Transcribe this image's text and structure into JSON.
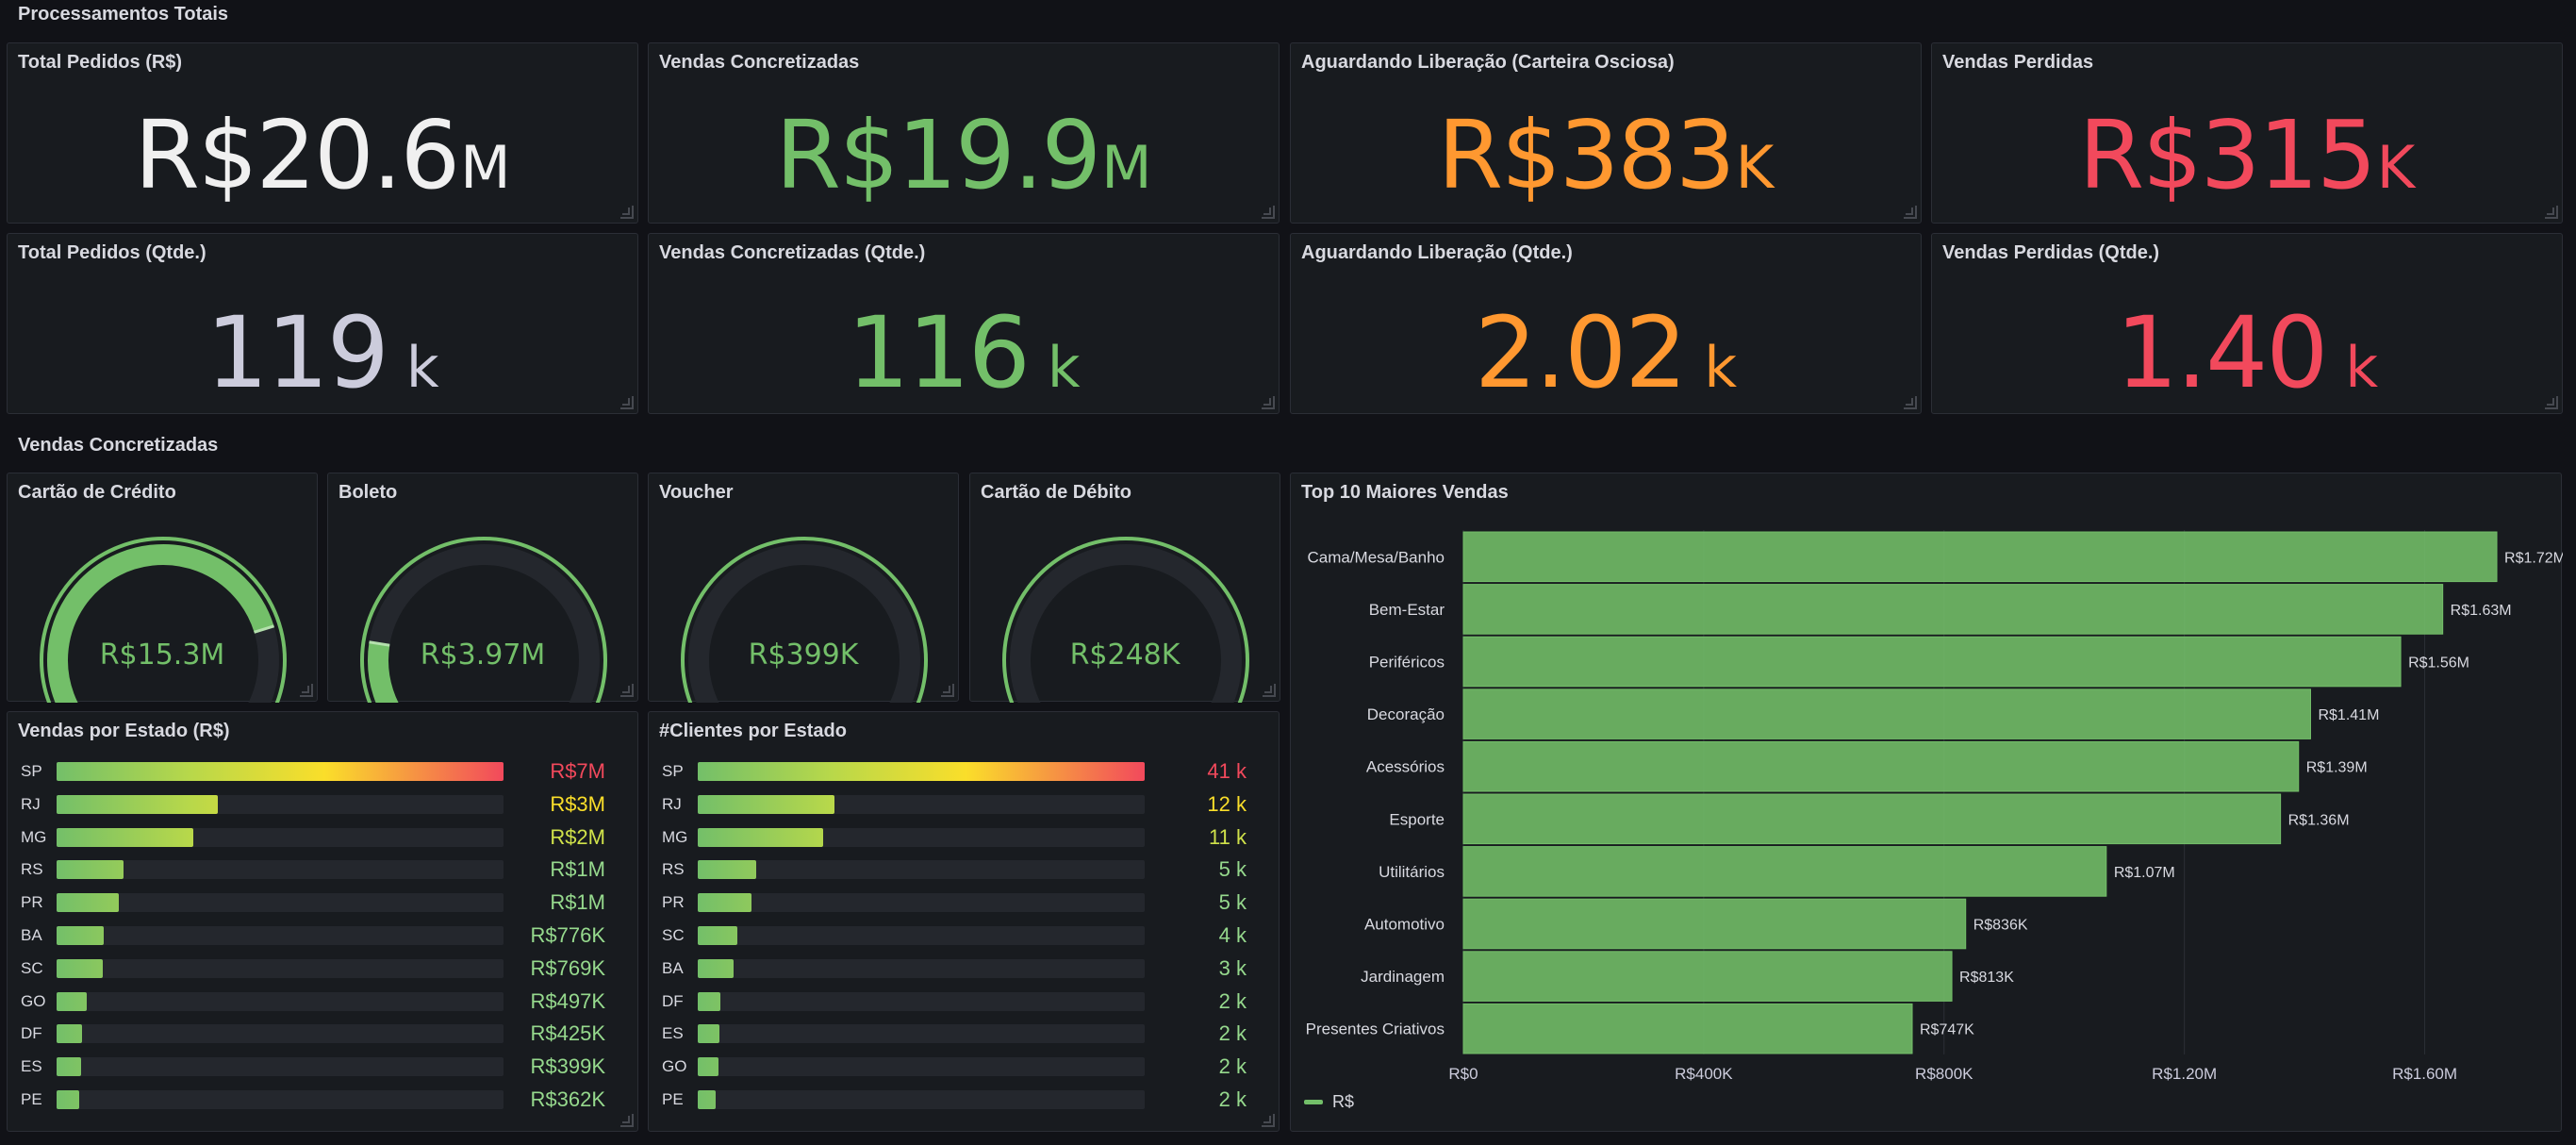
{
  "rows": {
    "totals": "Processamentos Totais",
    "concretized": "Vendas Concretizadas"
  },
  "stats": [
    {
      "title": "Total Pedidos (R$)",
      "value": "R$20.6",
      "unit": "M",
      "color": "#f0f0f0"
    },
    {
      "title": "Vendas Concretizadas",
      "value": "R$19.9",
      "unit": "M",
      "color": "#73bf69"
    },
    {
      "title": "Aguardando Liberação (Carteira Osciosa)",
      "value": "R$383",
      "unit": "K",
      "color": "#ff9830"
    },
    {
      "title": "Vendas Perdidas",
      "value": "R$315",
      "unit": "K",
      "color": "#f2495c"
    },
    {
      "title": "Total Pedidos (Qtde.)",
      "value": "119",
      "unit": "k",
      "color": "#ccccdc"
    },
    {
      "title": "Vendas Concretizadas (Qtde.)",
      "value": "116",
      "unit": "k",
      "color": "#73bf69"
    },
    {
      "title": "Aguardando Liberação (Qtde.)",
      "value": "2.02",
      "unit": "k",
      "color": "#ff9830"
    },
    {
      "title": "Vendas Perdidas (Qtde.)",
      "value": "1.40",
      "unit": "k",
      "color": "#f2495c"
    }
  ],
  "gauges": [
    {
      "title": "Cartão de Crédito",
      "value": "R$15.3M",
      "fraction": 0.77
    },
    {
      "title": "Boleto",
      "value": "R$3.97M",
      "fraction": 0.2
    },
    {
      "title": "Voucher",
      "value": "R$399K",
      "fraction": 0.025
    },
    {
      "title": "Cartão de Débito",
      "value": "R$248K",
      "fraction": 0.015
    }
  ],
  "states_value": {
    "title": "Vendas por Estado (R$)",
    "rows": [
      {
        "state": "SP",
        "value": "R$7M",
        "fraction": 1.0,
        "color": "#f2495c"
      },
      {
        "state": "RJ",
        "value": "R$3M",
        "fraction": 0.36,
        "color": "#fade2a"
      },
      {
        "state": "MG",
        "value": "R$2M",
        "fraction": 0.305,
        "color": "#d0e24a"
      },
      {
        "state": "RS",
        "value": "R$1M",
        "fraction": 0.15,
        "color": "#96d98d"
      },
      {
        "state": "PR",
        "value": "R$1M",
        "fraction": 0.14,
        "color": "#96d98d"
      },
      {
        "state": "BA",
        "value": "R$776K",
        "fraction": 0.105,
        "color": "#96d98d"
      },
      {
        "state": "SC",
        "value": "R$769K",
        "fraction": 0.103,
        "color": "#96d98d"
      },
      {
        "state": "GO",
        "value": "R$497K",
        "fraction": 0.068,
        "color": "#96d98d"
      },
      {
        "state": "DF",
        "value": "R$425K",
        "fraction": 0.058,
        "color": "#96d98d"
      },
      {
        "state": "ES",
        "value": "R$399K",
        "fraction": 0.054,
        "color": "#96d98d"
      },
      {
        "state": "PE",
        "value": "R$362K",
        "fraction": 0.05,
        "color": "#96d98d"
      }
    ]
  },
  "states_clients": {
    "title": "#Clientes por Estado",
    "rows": [
      {
        "state": "SP",
        "value": "41 k",
        "fraction": 1.0,
        "color": "#f2495c"
      },
      {
        "state": "RJ",
        "value": "12 k",
        "fraction": 0.305,
        "color": "#fade2a"
      },
      {
        "state": "MG",
        "value": "11 k",
        "fraction": 0.28,
        "color": "#d0e24a"
      },
      {
        "state": "RS",
        "value": "5 k",
        "fraction": 0.13,
        "color": "#96d98d"
      },
      {
        "state": "PR",
        "value": "5 k",
        "fraction": 0.12,
        "color": "#96d98d"
      },
      {
        "state": "SC",
        "value": "4 k",
        "fraction": 0.088,
        "color": "#96d98d"
      },
      {
        "state": "BA",
        "value": "3 k",
        "fraction": 0.08,
        "color": "#96d98d"
      },
      {
        "state": "DF",
        "value": "2 k",
        "fraction": 0.05,
        "color": "#96d98d"
      },
      {
        "state": "ES",
        "value": "2 k",
        "fraction": 0.048,
        "color": "#96d98d"
      },
      {
        "state": "GO",
        "value": "2 k",
        "fraction": 0.046,
        "color": "#96d98d"
      },
      {
        "state": "PE",
        "value": "2 k",
        "fraction": 0.04,
        "color": "#96d98d"
      }
    ]
  },
  "chart_data": {
    "type": "bar",
    "orientation": "horizontal",
    "title": "Top 10 Maiores Vendas",
    "categories": [
      "Cama/Mesa/Banho",
      "Bem-Estar",
      "Periféricos",
      "Decoração",
      "Acessórios",
      "Esporte",
      "Utilitários",
      "Automotivo",
      "Jardinagem",
      "Presentes Criativos"
    ],
    "values": [
      1720000,
      1630000,
      1560000,
      1410000,
      1390000,
      1360000,
      1070000,
      836000,
      813000,
      747000
    ],
    "value_labels": [
      "R$1.72M",
      "R$1.63M",
      "R$1.56M",
      "R$1.41M",
      "R$1.39M",
      "R$1.36M",
      "R$1.07M",
      "R$836K",
      "R$813K",
      "R$747K"
    ],
    "x_ticks": [
      "R$0",
      "R$400K",
      "R$800K",
      "R$1.20M",
      "R$1.60M"
    ],
    "xlim": [
      0,
      1800000
    ],
    "legend": [
      {
        "name": "R$",
        "color": "#73bf69"
      }
    ],
    "legend_position": "bottom-left",
    "bar_color": "#73bf69"
  }
}
